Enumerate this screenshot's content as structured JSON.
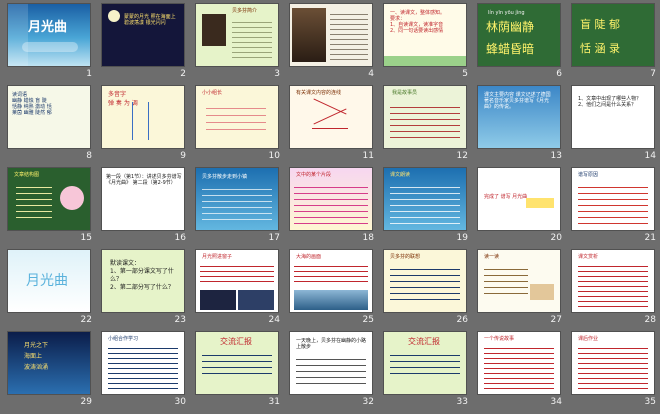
{
  "slides": [
    {
      "n": "1",
      "title": "月光曲"
    },
    {
      "n": "2",
      "text": "蒙蒙的月光 照在海面上\n碧波荡漾 银光闪闪"
    },
    {
      "n": "3",
      "text": "贝多芬简介"
    },
    {
      "n": "4",
      "text": "贝多芬"
    },
    {
      "n": "5",
      "text": "一、读课文，整体感知。\n要求：\n1、自读课文，读准字音\n2、同一句话要读出感情"
    },
    {
      "n": "6",
      "pinyin1": "lín  yīn  yōu  jìng",
      "chars1": "林荫幽静",
      "chars2": "蜂蜡昏暗"
    },
    {
      "n": "7",
      "chars1": "盲 陡 郁",
      "chars2": "恬 涵 录"
    },
    {
      "n": "8",
      "text": "读词语\n幽静 蜡烛 盲 陡\n恬静 纯熟 激动 恬\n莱茵 幽雅 陡然 郁"
    },
    {
      "n": "9",
      "text": "多音字\n弹 奏 为 调"
    },
    {
      "n": "10",
      "text": "小小组长"
    },
    {
      "n": "11",
      "text": "有关课文内容的连线"
    },
    {
      "n": "12",
      "text": "我是故事员"
    },
    {
      "n": "13",
      "text": "课文主要内容\n课文记述了德国著名音乐家贝多芬谱写《月光曲》的传说。"
    },
    {
      "n": "14",
      "text": "1、文章中出现了哪些人物？\n2、他们之间是什么关系？"
    },
    {
      "n": "15",
      "text": "文章结构图"
    },
    {
      "n": "16",
      "text": "第一段（第1节）：讲述贝多芬谱写《月光曲》\n第二段（第2-9节）"
    },
    {
      "n": "17",
      "text": "贝多芬散步走到小镇"
    },
    {
      "n": "18",
      "text": "文中的某个片段"
    },
    {
      "n": "19",
      "text": "课文朗读"
    },
    {
      "n": "20",
      "text": "完成了 谱写 月光曲"
    },
    {
      "n": "21",
      "text": "谱写原因"
    },
    {
      "n": "22",
      "title": "月光曲"
    },
    {
      "n": "23",
      "text": "默读课文：\n1、第一部分课文写了什么？\n2、第二部分写了什么？"
    },
    {
      "n": "24",
      "text": "月光照进窗子"
    },
    {
      "n": "25",
      "text": "大海的画面"
    },
    {
      "n": "26",
      "text": "贝多芬的联想"
    },
    {
      "n": "27",
      "text": "读一读"
    },
    {
      "n": "28",
      "text": "课文赏析"
    },
    {
      "n": "29",
      "text": "月光之下\n海面上\n波涛汹涌"
    },
    {
      "n": "30",
      "text": "小组合作学习"
    },
    {
      "n": "31",
      "title": "交流汇报"
    },
    {
      "n": "32",
      "text": "一天晚上，贝多芬在幽静的小路上散步"
    },
    {
      "n": "33",
      "title": "交流汇报"
    },
    {
      "n": "34",
      "text": "一个传说故事"
    },
    {
      "n": "35",
      "text": "课后作业"
    }
  ],
  "colors": {
    "background": "#6d6d6d",
    "number": "#f2f2f2"
  }
}
